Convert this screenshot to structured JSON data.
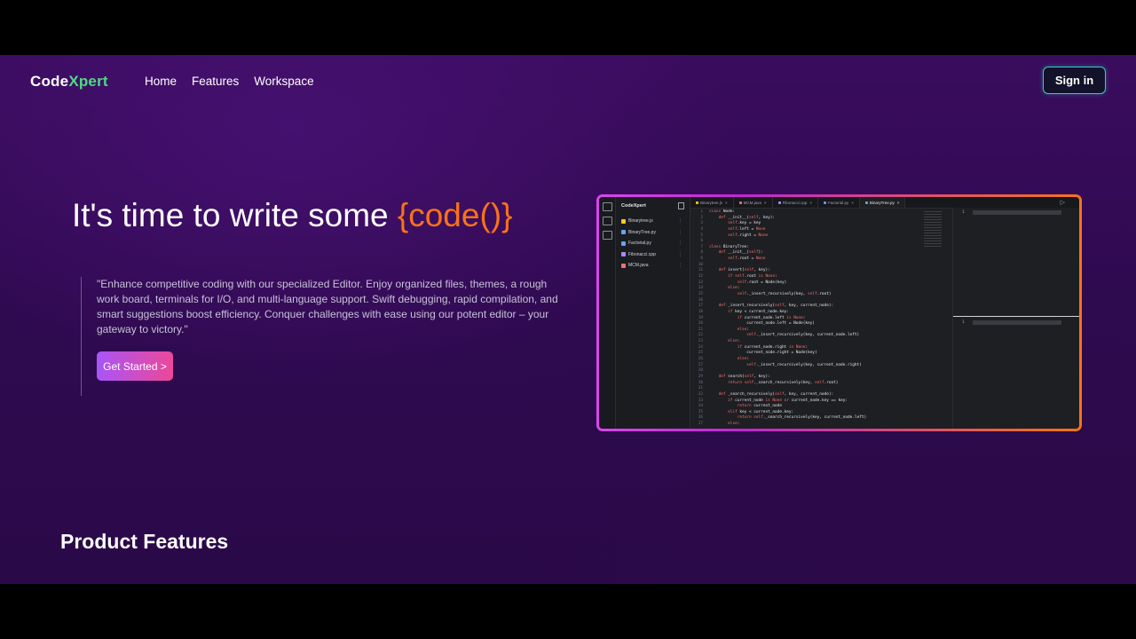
{
  "brand": {
    "prefix": "Code",
    "accent": "Xpert"
  },
  "nav": [
    {
      "label": "Home"
    },
    {
      "label": "Features"
    },
    {
      "label": "Workspace"
    }
  ],
  "signin_label": "Sign in",
  "hero": {
    "title_prefix": "It's time to write some ",
    "title_code": "{code()}",
    "quote": "\"Enhance competitive coding with our specialized Editor. Enjoy organized files, themes, a rough work board, terminals for I/O, and multi-language support. Swift debugging, rapid compilation, and smart suggestions boost efficiency. Conquer challenges with ease using our potent editor – your gateway to victory.\"",
    "cta": "Get Started >"
  },
  "features_heading": "Product Features",
  "editor": {
    "explorer_title": "CodeXpert",
    "files": [
      {
        "name": "Binarytree.js",
        "color": "#facc15"
      },
      {
        "name": "BinaryTree.py",
        "color": "#60a5fa"
      },
      {
        "name": "Factorial.py",
        "color": "#60a5fa"
      },
      {
        "name": "Fibonacci.cpp",
        "color": "#a78bfa"
      },
      {
        "name": "MCM.java",
        "color": "#f87171"
      }
    ],
    "tabs": [
      {
        "name": "Binarytree.js",
        "color": "#facc15",
        "active": false
      },
      {
        "name": "MCM.java",
        "color": "#f87171",
        "active": false
      },
      {
        "name": "Fibonacci.cpp",
        "color": "#a78bfa",
        "active": false
      },
      {
        "name": "Factorial.py",
        "color": "#60a5fa",
        "active": false
      },
      {
        "name": "BinaryTree.py",
        "color": "#60a5fa",
        "active": true
      }
    ],
    "code_lines": [
      "class Node:",
      "    def __init__(self, key):",
      "        self.key = key",
      "        self.left = None",
      "        self.right = None",
      "",
      "class BinaryTree:",
      "    def __init__(self):",
      "        self.root = None",
      "",
      "    def insert(self, key):",
      "        if self.root is None:",
      "            self.root = Node(key)",
      "        else:",
      "            self._insert_recursively(key, self.root)",
      "",
      "    def _insert_recursively(self, key, current_node):",
      "        if key < current_node.key:",
      "            if current_node.left is None:",
      "                current_node.left = Node(key)",
      "            else:",
      "                self._insert_recursively(key, current_node.left)",
      "        else:",
      "            if current_node.right is None:",
      "                current_node.right = Node(key)",
      "            else:",
      "                self._insert_recursively(key, current_node.right)",
      "",
      "    def search(self, key):",
      "        return self._search_recursively(key, self.root)",
      "",
      "    def _search_recursively(self, key, current_node):",
      "        if current_node is None or current_node.key == key:",
      "            return current_node",
      "        elif key < current_node.key:",
      "            return self._search_recursively(key, current_node.left)",
      "        else:"
    ],
    "io_line_number": "1"
  },
  "colors": {
    "brand_accent": "#4ade80",
    "code_accent": "#f97316",
    "signin_border": "#2dd4bf",
    "cta_gradient_start": "#a855f7",
    "cta_gradient_end": "#ec4899"
  }
}
